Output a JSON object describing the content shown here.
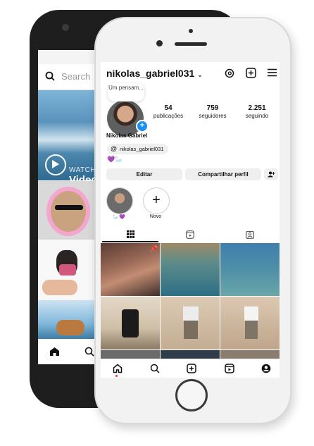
{
  "back_phone": {
    "search": {
      "placeholder": "Search",
      "icon": "search-icon"
    },
    "reel_overlay": {
      "watch_label": "WATCH",
      "video_label": "Video"
    },
    "bottom_nav": {
      "items": [
        "home-icon",
        "search-icon"
      ]
    }
  },
  "profile": {
    "username": "nikolas_gabriel031",
    "note_text": "Um pensam...",
    "stats": [
      {
        "value": "54",
        "label": "publicações"
      },
      {
        "value": "759",
        "label": "seguidores"
      },
      {
        "value": "2.251",
        "label": "seguindo"
      }
    ],
    "full_name": "Nikolas Gabriel",
    "threads_handle": "nikolas_gabriel031",
    "bio_emojis": "💜🦢",
    "buttons": {
      "edit": "Editar",
      "share": "Compartilhar perfil"
    },
    "highlights": [
      {
        "label": "🦢💜"
      },
      {
        "label": "Novo"
      }
    ],
    "tabs": [
      "grid-icon",
      "reels-icon",
      "tagged-icon"
    ],
    "header_icons": [
      "threads-icon",
      "add-post-icon",
      "menu-icon"
    ]
  },
  "bottom_nav": {
    "items": [
      "home-icon",
      "search-icon",
      "create-icon",
      "reels-icon",
      "profile-icon"
    ]
  },
  "colors": {
    "accent_blue": "#1a8ff1",
    "notification_red": "#ff3040",
    "button_gray": "#efefef"
  }
}
